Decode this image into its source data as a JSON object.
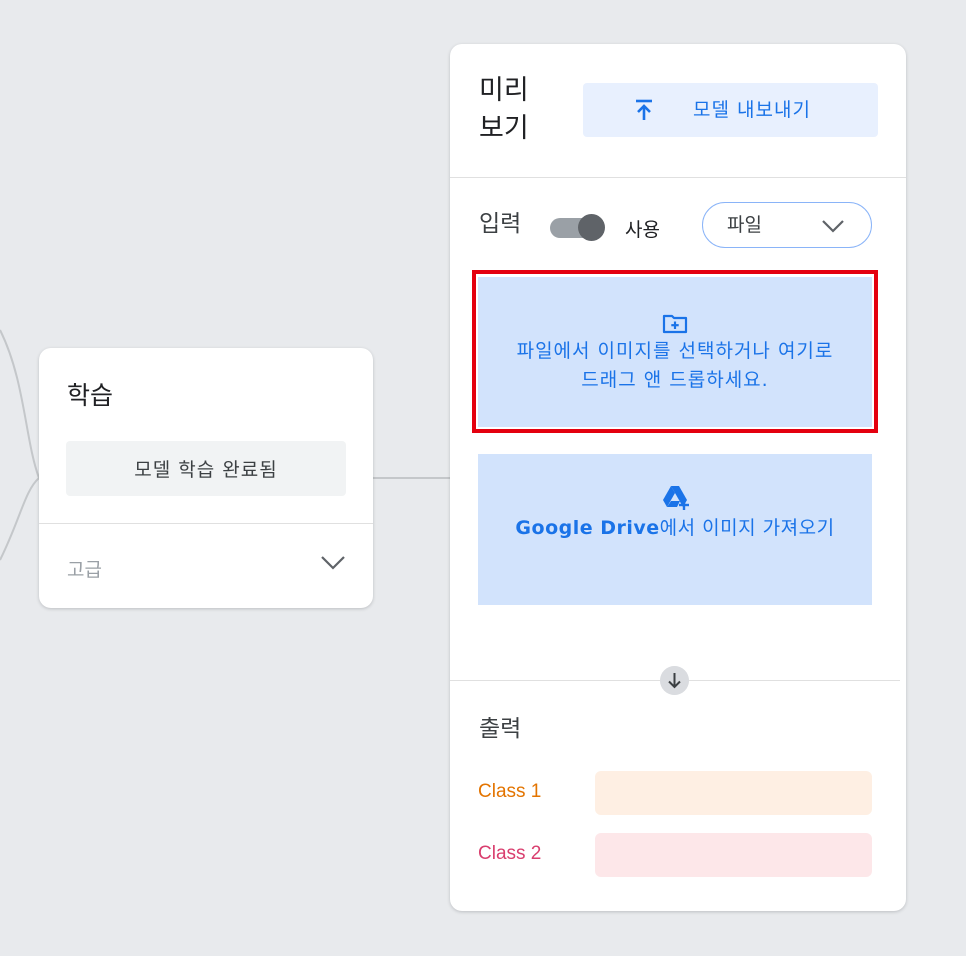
{
  "training": {
    "title": "학습",
    "status": "모델 학습 완료됨",
    "advanced_label": "고급",
    "advanced_icon": "chevron-down-icon"
  },
  "preview": {
    "title": "미리 보기",
    "export_label": "모델 내보내기",
    "export_icon": "upload-icon",
    "input_label": "입력",
    "toggle_label": "사용",
    "toggle_on": true,
    "source_selected": "파일",
    "dropzone_text": "파일에서 이미지를 선택하거나 여기로 드래그 앤 드롭하세요.",
    "dropzone_icon": "add-folder-icon",
    "drive_brand": "Google Drive",
    "drive_text": "에서 이미지 가져오기",
    "drive_icon": "google-drive-icon",
    "output_label": "출력",
    "classes": [
      {
        "label": "Class 1",
        "label_color": "#e37400",
        "bar_color": "#feefe3"
      },
      {
        "label": "Class 2",
        "label_color": "#d93e6e",
        "bar_color": "#fde7e9"
      }
    ]
  },
  "colors": {
    "background": "#e8eaed",
    "accent": "#1a73e8",
    "highlight_border": "#e4000f"
  }
}
